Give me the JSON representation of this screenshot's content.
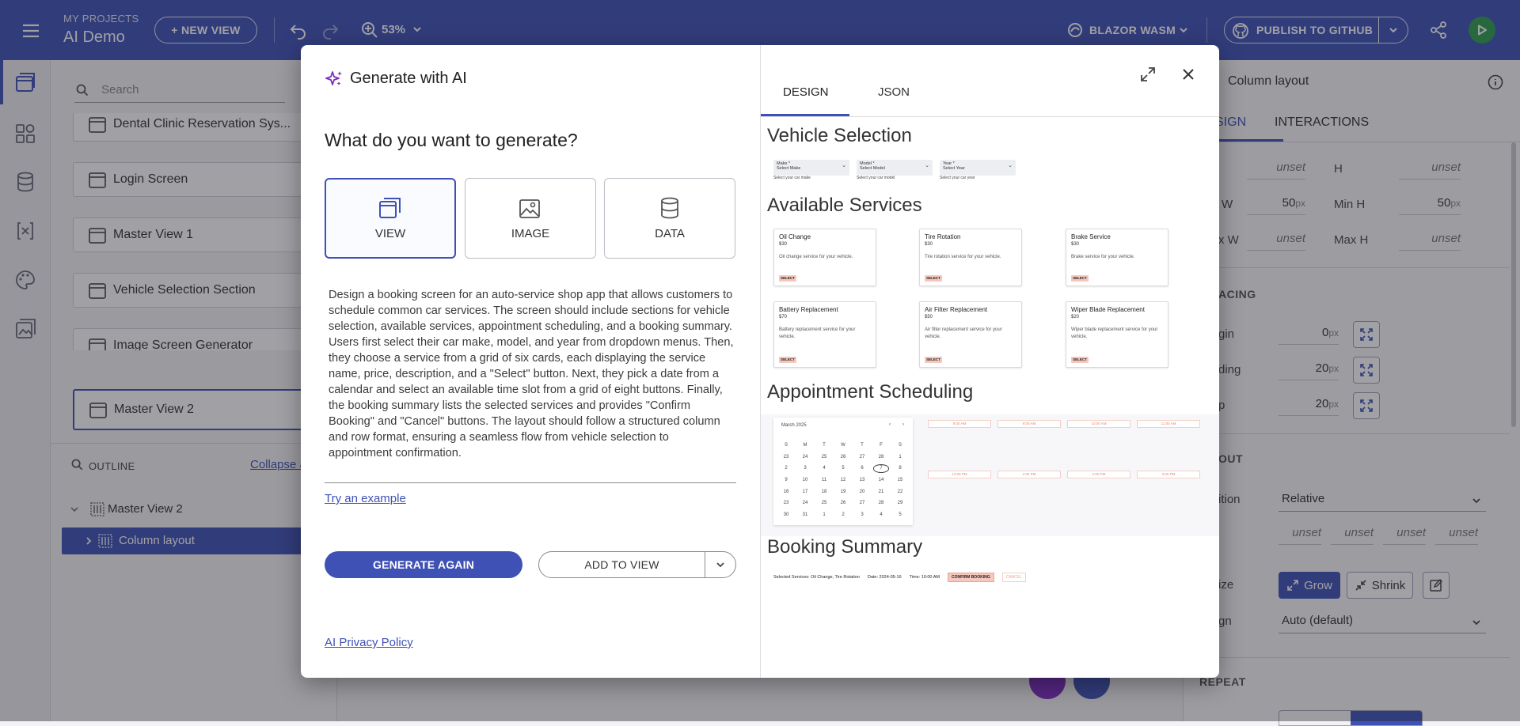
{
  "topbar": {
    "project_caption": "MY PROJECTS",
    "project_name": "AI Demo",
    "new_view": "+ NEW VIEW",
    "zoom": "53%",
    "platform": "BLAZOR WASM",
    "publish": "PUBLISH TO GITHUB"
  },
  "left_panel": {
    "search_placeholder": "Search",
    "views": [
      "Dental Clinic Reservation Sys...",
      "Login Screen",
      "Master View 1",
      "Vehicle Selection Section",
      "Image Screen Generator",
      "Master View 2"
    ],
    "selected_view": "Master View 2",
    "outline_label": "OUTLINE",
    "collapse_label": "Collapse a",
    "tree": [
      "Master View 2",
      "Column layout"
    ]
  },
  "right_panel": {
    "title": "Column layout",
    "tabs": [
      "SIGN",
      "INTERACTIONS"
    ],
    "w_label": "W",
    "w_val": "unset",
    "h_label": "H",
    "h_val": "unset",
    "minw_label": "W",
    "minw_val": "50",
    "minh_label": "Min H",
    "minh_val": "50",
    "maxw_label": "x W",
    "maxw_val": "unset",
    "maxh_label": "Max H",
    "maxh_val": "unset",
    "spacing_section": "ACING",
    "margin_label": "gin",
    "margin_val": "0",
    "padding_label": "ding",
    "padding_val": "20",
    "gap_label": "p",
    "gap_val": "20",
    "layout_section": "OUT",
    "position_label": "ition",
    "position_val": "Relative",
    "inset_vals": [
      "unset",
      "unset",
      "unset",
      "unset"
    ],
    "size_label": "ize",
    "grow": "Grow",
    "shrink": "Shrink",
    "align_label": "gn",
    "align_val": "Auto (default)",
    "repeat_section": "REPEAT",
    "unit": "px"
  },
  "modal": {
    "title": "Generate with AI",
    "question": "What do you want to generate?",
    "types": [
      "VIEW",
      "IMAGE",
      "DATA"
    ],
    "selected_type": "VIEW",
    "prompt": "Design a booking screen for an auto-service shop app that allows customers to schedule common car services. The screen should include sections for vehicle selection, available services, appointment scheduling, and a booking summary. Users first select their car make, model, and year from dropdown menus. Then, they choose a service from a grid of six cards, each displaying the service name, price, description, and a \"Select\" button. Next, they pick a date from a calendar and select an available time slot from a grid of eight buttons. Finally, the booking summary lists the selected services and provides \"Confirm Booking\" and \"Cancel\" buttons. The layout should follow a structured column and row format, ensuring a seamless flow from vehicle selection to appointment confirmation.",
    "try_example": "Try an example",
    "generate_again": "GENERATE AGAIN",
    "add_to_view": "ADD TO VIEW",
    "privacy": "AI Privacy Policy",
    "preview_tabs": [
      "DESIGN",
      "JSON"
    ],
    "active_preview_tab": "DESIGN"
  },
  "preview": {
    "vehicle_heading": "Vehicle Selection",
    "dropdowns": [
      {
        "label": "Make *",
        "value": "Select Make",
        "help": "Select your car make"
      },
      {
        "label": "Model *",
        "value": "Select Model",
        "help": "Select your car model"
      },
      {
        "label": "Year *",
        "value": "Select Year",
        "help": "Select your car year"
      }
    ],
    "services_heading": "Available Services",
    "services": [
      {
        "name": "Oil Change",
        "price": "$30",
        "desc": "Oil change service for your vehicle."
      },
      {
        "name": "Tire Rotation",
        "price": "$30",
        "desc": "Tire rotation service for your vehicle."
      },
      {
        "name": "Brake Service",
        "price": "$30",
        "desc": "Brake service for your vehicle."
      },
      {
        "name": "Battery Replacement",
        "price": "$70",
        "desc": "Battery replacement service for your vehicle."
      },
      {
        "name": "Air Filter Replacement",
        "price": "$50",
        "desc": "Air filter replacement service for your vehicle."
      },
      {
        "name": "Wiper Blade Replacement",
        "price": "$20",
        "desc": "Wiper blade replacement service for your vehicle."
      }
    ],
    "select_label": "SELECT",
    "appointment_heading": "Appointment Scheduling",
    "calendar_month": "March 2025",
    "weekdays": [
      "S",
      "M",
      "T",
      "W",
      "T",
      "F",
      "S"
    ],
    "calendar_rows": [
      [
        "23",
        "24",
        "25",
        "26",
        "27",
        "28",
        "1"
      ],
      [
        "2",
        "3",
        "4",
        "5",
        "6",
        "7",
        "8"
      ],
      [
        "9",
        "10",
        "11",
        "12",
        "13",
        "14",
        "15"
      ],
      [
        "16",
        "17",
        "18",
        "19",
        "20",
        "21",
        "22"
      ],
      [
        "23",
        "24",
        "25",
        "26",
        "27",
        "28",
        "29"
      ],
      [
        "30",
        "31",
        "1",
        "2",
        "3",
        "4",
        "5"
      ]
    ],
    "today": "7",
    "time_slots": [
      "9:00 AM",
      "9:00 AM",
      "10:00 AM",
      "11:00 AM",
      "12:00 PM",
      "1:00 PM",
      "2:00 PM",
      "3:00 PM"
    ],
    "summary_heading": "Booking Summary",
    "summary_services": "Selected Services: Oil Change, Tire Rotation",
    "summary_date": "Date: 2024-05-16",
    "summary_time": "Time: 10:00 AM",
    "confirm": "CONFIRM BOOKING",
    "cancel": "CANCEL"
  },
  "colors": {
    "primary": "#3f51b5",
    "accent_pink": "#f6c7bd",
    "fab_purple": "#7b2cbf"
  }
}
